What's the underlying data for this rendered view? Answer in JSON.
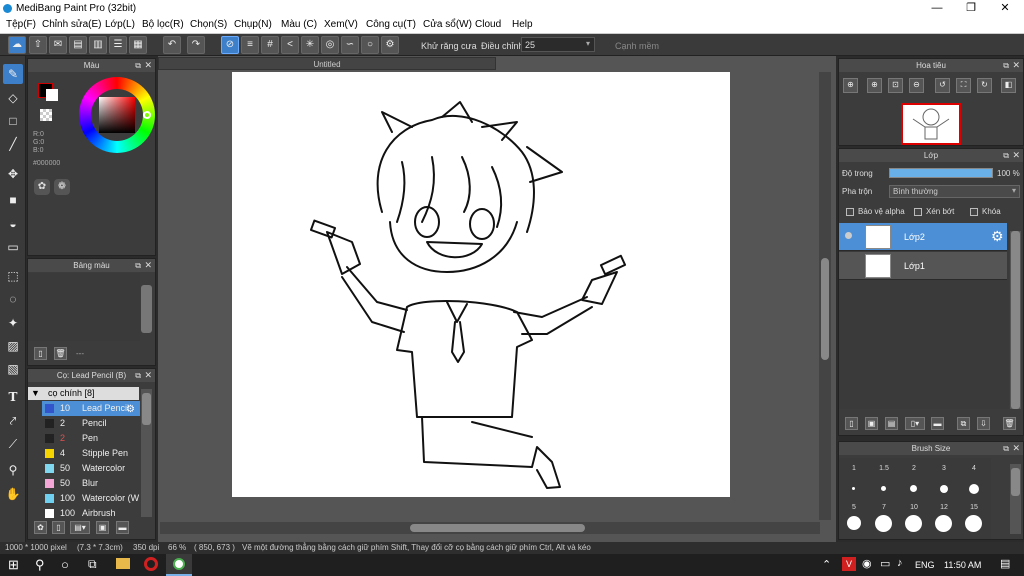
{
  "window": {
    "title": "MediBang Paint Pro (32bit)",
    "minimize": "—",
    "restore": "❐",
    "close": "✕"
  },
  "menu": [
    "Tệp(F)",
    "Chỉnh sửa(E)",
    "Lớp(L)",
    "Bộ lọc(R)",
    "Chọn(S)",
    "Chụp(N)",
    "Màu (C)",
    "Xem(V)",
    "Công cụ(T)",
    "Cửa sổ(W)",
    "Cloud",
    "Help"
  ],
  "toolbar": {
    "antialias_label": "Khử răng cưa",
    "adjust_label": "Điều chỉnh",
    "adjust_value": "25",
    "edge_label": "Cạnh mềm"
  },
  "color_panel": {
    "title": "Màu",
    "r": "R:0",
    "g": "G:0",
    "b": "B:0",
    "hex": "#000000"
  },
  "palette_panel": {
    "title": "Bảng màu",
    "more": "---"
  },
  "brush_panel": {
    "title": "Cọ: Lead Pencil (B)",
    "group": "cọ chính [8]",
    "brushes": [
      {
        "size": "10",
        "name": "Lead Pencil",
        "color": "#3355cc"
      },
      {
        "size": "2",
        "name": "Pencil",
        "color": "#222222"
      },
      {
        "size": "2",
        "name": "Pen",
        "color": "#222222"
      },
      {
        "size": "4",
        "name": "Stipple Pen",
        "color": "#f5d400"
      },
      {
        "size": "50",
        "name": "Watercolor",
        "color": "#7fd8f0"
      },
      {
        "size": "50",
        "name": "Blur",
        "color": "#f4a6d6"
      },
      {
        "size": "100",
        "name": "Watercolor (W",
        "color": "#6fd0f0"
      },
      {
        "size": "100",
        "name": "Airbrush",
        "color": "#ffffff"
      }
    ]
  },
  "canvas": {
    "tab_title": "Untitled"
  },
  "navigator_panel": {
    "title": "Hoa tiêu"
  },
  "layer_panel": {
    "title": "Lớp",
    "opacity_label": "Độ trong",
    "opacity_value": "100 %",
    "blend_label": "Pha trộn",
    "blend_value": "Bình thường",
    "protect_alpha": "Bảo vệ alpha",
    "clipping": "Xén bớt",
    "lock": "Khóa",
    "layers": [
      {
        "name": "Lớp2",
        "selected": true
      },
      {
        "name": "Lớp1",
        "selected": false
      }
    ]
  },
  "brush_size_panel": {
    "title": "Brush Size",
    "row1": [
      "1",
      "1.5",
      "2",
      "3",
      "4"
    ],
    "row2": [
      "5",
      "7",
      "10",
      "12",
      "15"
    ]
  },
  "status": {
    "size": "1000 * 1000 pixel",
    "cm": "(7.3 * 7.3cm)",
    "dpi": "350 dpi",
    "zoom": "66 %",
    "coords": "( 850, 673 )",
    "hint": "Vẽ một đường thẳng bằng cách giữ phím Shift, Thay đổi cỡ cọ bằng cách giữ phím Ctrl, Alt và kéo"
  },
  "taskbar": {
    "language": "ENG",
    "time": "11:50 AM"
  }
}
